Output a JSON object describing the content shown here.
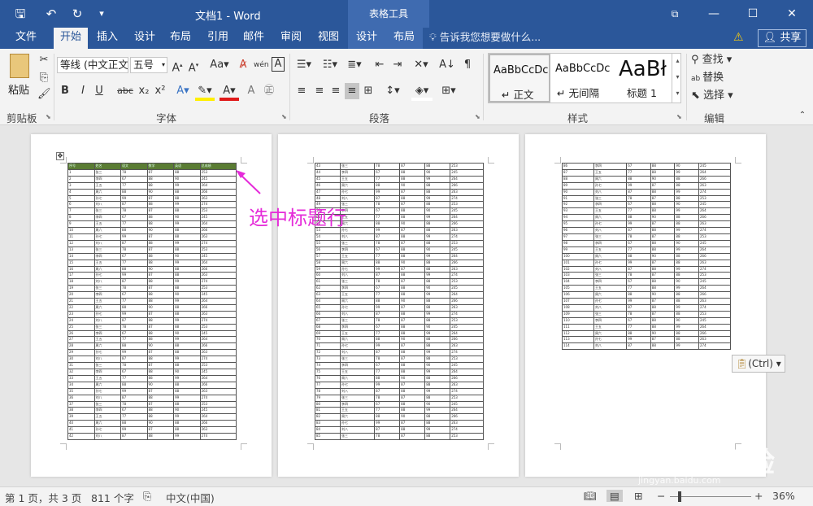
{
  "app": {
    "document_title": "文档1 - Word",
    "context_tab_header": "表格工具"
  },
  "quick_access": {
    "save_icon": "save-icon",
    "undo_icon": "undo-icon",
    "redo_icon": "redo-icon",
    "customize_icon": "customize-icon"
  },
  "window": {
    "help_icon": "ribbon-display-icon",
    "minimize": "—",
    "maximize": "☐",
    "close": "✕"
  },
  "tabs": [
    "文件",
    "开始",
    "插入",
    "设计",
    "布局",
    "引用",
    "邮件",
    "审阅",
    "视图",
    "设计",
    "布局"
  ],
  "active_tab": "开始",
  "tell_me": "告诉我您想要做什么...",
  "share": "共享",
  "ribbon": {
    "clipboard": {
      "label": "剪贴板",
      "paste": "粘贴"
    },
    "font": {
      "label": "字体",
      "font_name": "等线 (中文正文)",
      "font_size": "五号",
      "clear_fmt": "A",
      "bold": "B",
      "italic": "I",
      "underline": "U",
      "strike": "abc",
      "subscript": "x₂",
      "superscript": "x²"
    },
    "paragraph": {
      "label": "段落"
    },
    "styles": {
      "label": "样式",
      "items": [
        {
          "preview": "AaBbCcDc",
          "name": "↵ 正文"
        },
        {
          "preview": "AaBbCcDc",
          "name": "↵ 无间隔"
        },
        {
          "preview": "AaBł",
          "name": "标题 1"
        }
      ]
    },
    "editing": {
      "label": "编辑",
      "find": "查找",
      "replace": "替换",
      "select": "选择"
    }
  },
  "annotation": "选中标题行",
  "paste_options": "(Ctrl)",
  "watermark": {
    "main": "Baidu经验",
    "url": "jingyan.baidu.com"
  },
  "table": {
    "headers": [
      "序号",
      "姓名",
      "语文",
      "数学",
      "英语",
      "总成绩"
    ],
    "names": [
      "张三",
      "李四",
      "王五",
      "周六",
      "孙七",
      "刘八"
    ],
    "scores": [
      [
        78,
        87,
        88,
        253
      ],
      [
        67,
        88,
        90,
        245
      ],
      [
        77,
        88,
        99,
        264
      ],
      [
        88,
        90,
        88,
        266
      ],
      [
        99,
        87,
        88,
        263
      ],
      [
        87,
        88,
        99,
        274
      ]
    ]
  },
  "status": {
    "page": "第 1 页，共 3 页",
    "words": "811 个字",
    "lang": "中文(中国)",
    "zoom": "36%"
  }
}
